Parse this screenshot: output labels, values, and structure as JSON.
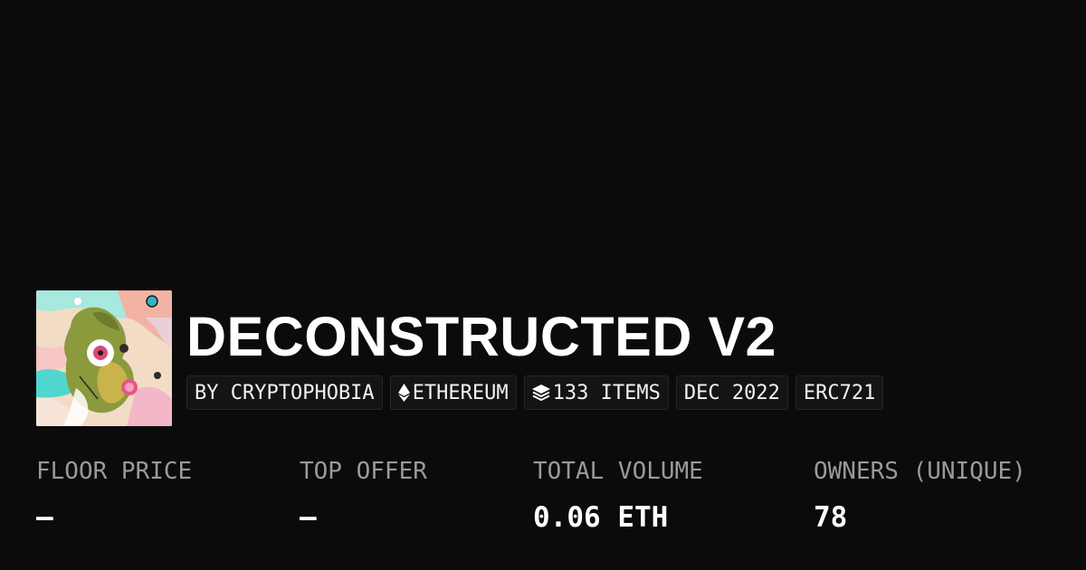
{
  "collection": {
    "title": "DECONSTRUCTED V2",
    "avatar_icon": "collection-artwork",
    "tags": {
      "creator": "BY CRYPTOPHOBIA",
      "chain": "ETHEREUM",
      "chain_icon": "ethereum-icon",
      "items": "133 ITEMS",
      "items_icon": "layers-icon",
      "date": "DEC 2022",
      "standard": "ERC721"
    }
  },
  "stats": {
    "floor_price": {
      "label": "FLOOR PRICE",
      "value": "–"
    },
    "top_offer": {
      "label": "TOP OFFER",
      "value": "–"
    },
    "total_volume": {
      "label": "TOTAL VOLUME",
      "value": "0.06 ETH"
    },
    "owners": {
      "label": "OWNERS (UNIQUE)",
      "value": "78"
    }
  },
  "colors": {
    "background": "#0b0b0b",
    "tag_background": "#141414",
    "label": "#9a9a9a",
    "text": "#ffffff"
  }
}
